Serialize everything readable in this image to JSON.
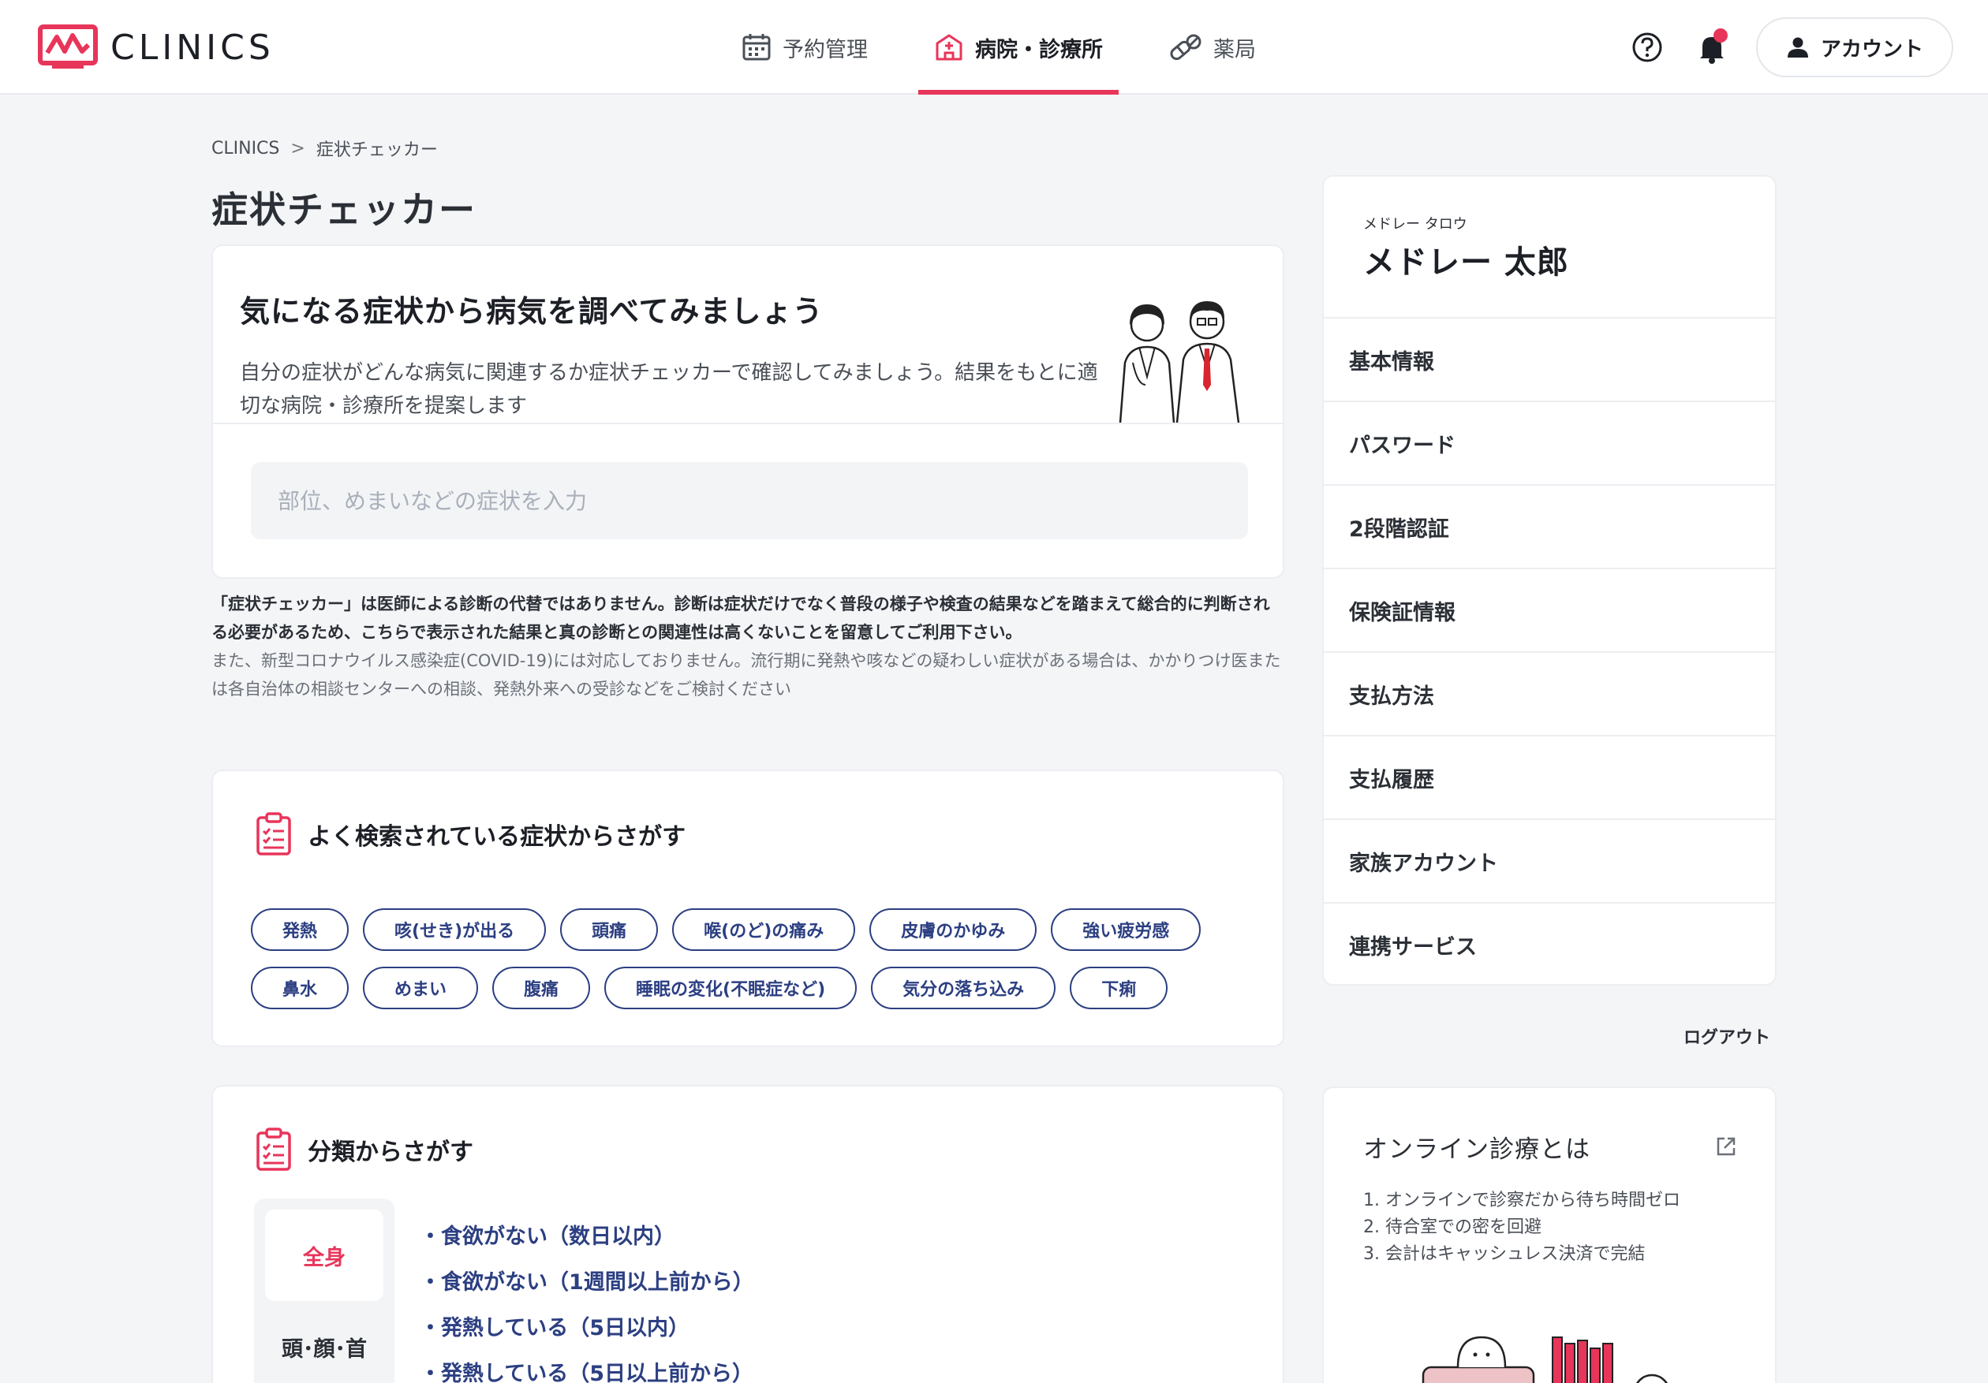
{
  "header": {
    "logo_text": "CLINICS",
    "nav": [
      {
        "label": "予約管理",
        "icon": "calendar-icon",
        "active": false
      },
      {
        "label": "病院・診療所",
        "icon": "hospital-icon",
        "active": true
      },
      {
        "label": "薬局",
        "icon": "pill-icon",
        "active": false
      }
    ],
    "account_label": "アカウント",
    "accent_color": "#e8355a"
  },
  "breadcrumb": {
    "root": "CLINICS",
    "separator": ">",
    "current": "症状チェッカー"
  },
  "page_title": "症状チェッカー",
  "hero": {
    "title": "気になる症状から病気を調べてみましょう",
    "description": "自分の症状がどんな病気に関連するか症状チェッカーで確認してみましょう。結果をもとに適切な病院・診療所を提案します",
    "search_placeholder": "部位、めまいなどの症状を入力"
  },
  "disclaimer": {
    "bold_text": "「症状チェッカー」は医師による診断の代替ではありません。診断は症状だけでなく普段の様子や検査の結果などを踏まえて総合的に判断される必要があるため、こちらで表示された結果と真の診断との関連性は高くないことを留意してご利用下さい。",
    "muted_text": "また、新型コロナウイルス感染症(COVID-19)には対応しておりません。流行期に発熱や咳などの疑わしい症状がある場合は、かかりつけ医または各自治体の相談センターへの相談、発熱外来への受診などをご検討ください"
  },
  "popular": {
    "title": "よく検索されている症状からさがす",
    "chips_row1": [
      "発熱",
      "咳(せき)が出る",
      "頭痛",
      "喉(のど)の痛み",
      "皮膚のかゆみ",
      "強い疲労感"
    ],
    "chips_row2": [
      "鼻水",
      "めまい",
      "腹痛",
      "睡眠の変化(不眠症など)",
      "気分の落ち込み",
      "下痢"
    ]
  },
  "category": {
    "title": "分類からさがす",
    "tabs": [
      "全身",
      "頭･顔･首"
    ],
    "active_tab": "全身",
    "links": [
      "・食欲がない（数日以内）",
      "・食欲がない（1週間以上前から）",
      "・発熱している（5日以内）",
      "・発熱している（5日以上前から）"
    ]
  },
  "profile": {
    "kana": "メドレー タロウ",
    "name": "メドレー 太郎",
    "menu": [
      "基本情報",
      "パスワード",
      "2段階認証",
      "保険証情報",
      "支払方法",
      "支払履歴",
      "家族アカウント",
      "連携サービス"
    ],
    "logout": "ログアウト"
  },
  "online": {
    "title": "オンライン診療とは",
    "points": [
      "1. オンラインで診察だから待ち時間ゼロ",
      "2. 待合室での密を回避",
      "3. 会計はキャッシュレス決済で完結"
    ]
  }
}
